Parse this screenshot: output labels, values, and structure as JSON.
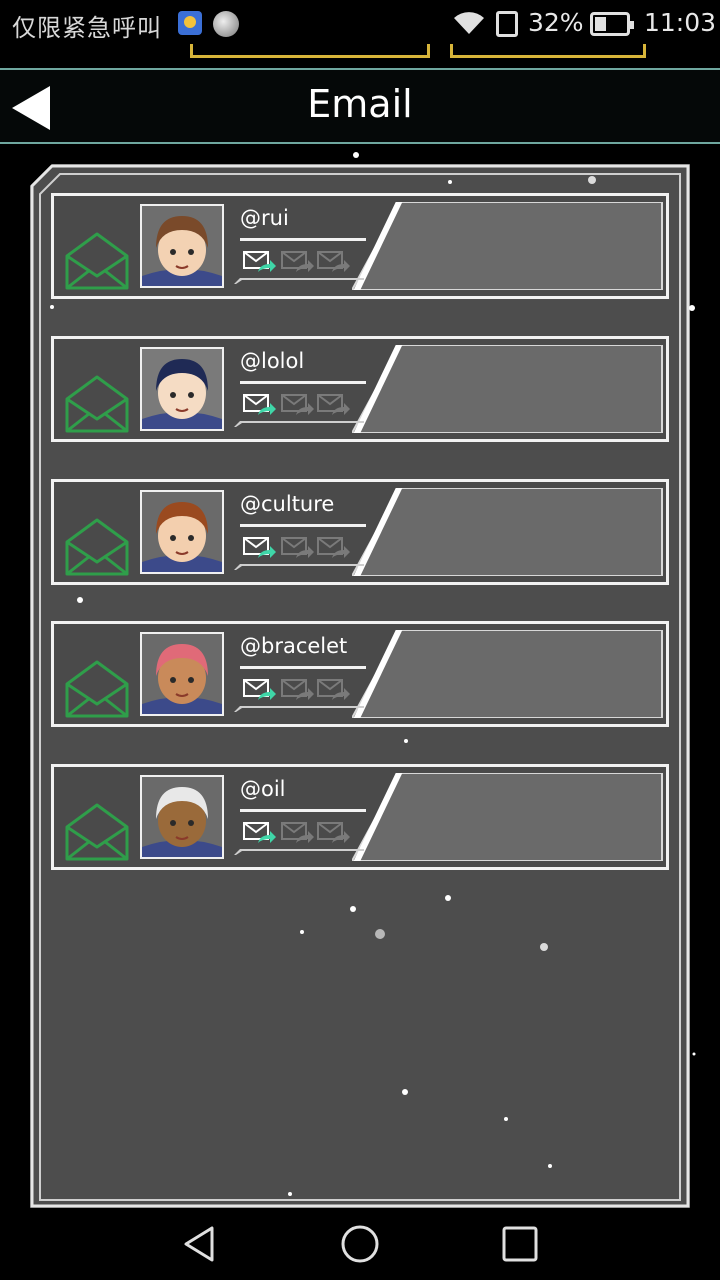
{
  "status_bar": {
    "carrier_text": "仅限紧急呼叫",
    "battery": "32%",
    "time": "11:03"
  },
  "header": {
    "title": "Email",
    "back_icon": "back-arrow-icon"
  },
  "emails": [
    {
      "handle": "@rui",
      "preview": "",
      "avatar_hair": "#7a4a2a",
      "avatar_skin": "#f3d2b3",
      "avatar_bg": "#6e6e6e"
    },
    {
      "handle": "@lolol",
      "preview": "",
      "avatar_hair": "#1f2a55",
      "avatar_skin": "#f5dcc4",
      "avatar_bg": "#7a7a7a"
    },
    {
      "handle": "@culture",
      "preview": "",
      "avatar_hair": "#9a4a1f",
      "avatar_skin": "#f3cfae",
      "avatar_bg": "#6a6a6a"
    },
    {
      "handle": "@bracelet",
      "preview": "",
      "avatar_hair": "#e06a78",
      "avatar_skin": "#c98a5a",
      "avatar_bg": "#6a6a6a"
    },
    {
      "handle": "@oil",
      "preview": "",
      "avatar_hair": "#e8e8e8",
      "avatar_skin": "#9a6a3a",
      "avatar_bg": "#6a6a6a"
    }
  ],
  "colors": {
    "envelope": "#2f9e4a",
    "reply_arrow": "#3fd6a8",
    "inactive_icon": "#8a8a8a",
    "panel": "#4d4d4d",
    "header_line": "#6fa79f"
  },
  "nav": {
    "back_icon": "nav-back-icon",
    "home_icon": "nav-home-icon",
    "recents_icon": "nav-recents-icon"
  }
}
